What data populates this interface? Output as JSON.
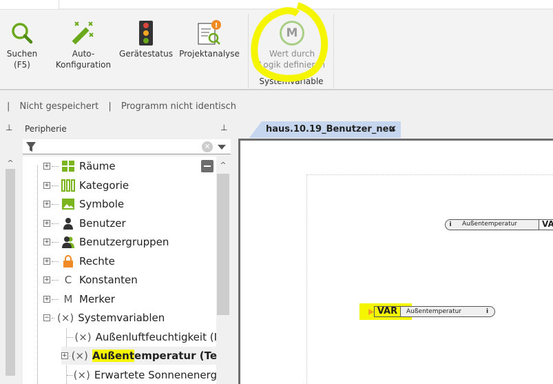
{
  "ribbon": {
    "buttons": [
      {
        "label1": "Suchen",
        "label2": "(F5)",
        "icon": "search-icon"
      },
      {
        "label1": "Auto-",
        "label2": "Konfiguration",
        "icon": "magic-wand-icon"
      },
      {
        "label1": "Gerätestatus",
        "label2": "",
        "icon": "traffic-light-icon"
      },
      {
        "label1": "Projektanalyse",
        "label2": "",
        "icon": "project-analysis-icon"
      },
      {
        "label1": "Wert durch",
        "label2": "Logik definieren",
        "icon": "m-circle-icon",
        "glyph": "M"
      }
    ],
    "group_label": "Systemvariable"
  },
  "status": {
    "sep": "|",
    "saved": "Nicht gespeichert",
    "program": "Programm nicht identisch"
  },
  "panel": {
    "title": "Peripherie",
    "pin": "⊥"
  },
  "tree": [
    {
      "label": "Räume",
      "icon": "rooms-icon",
      "expander": "+"
    },
    {
      "label": "Kategorie",
      "icon": "category-icon",
      "expander": "+"
    },
    {
      "label": "Symbole",
      "icon": "symbols-icon",
      "expander": "+"
    },
    {
      "label": "Benutzer",
      "icon": "user-icon",
      "expander": "+"
    },
    {
      "label": "Benutzergruppen",
      "icon": "user-group-icon",
      "expander": "+"
    },
    {
      "label": "Rechte",
      "icon": "lock-icon",
      "expander": "+"
    },
    {
      "label": "Konstanten",
      "icon": "constant-icon",
      "glyph": "C",
      "expander": "+"
    },
    {
      "label": "Merker",
      "icon": "marker-icon",
      "glyph": "M",
      "expander": "+"
    },
    {
      "label": "Systemvariablen",
      "icon": "variable-icon",
      "glyph": "(×)",
      "expander": "−"
    },
    {
      "label": "Außenluftfeuchtigkeit (I",
      "icon": "variable-icon",
      "glyph": "(×)"
    },
    {
      "label_hl": "Außent",
      "label_rest": "emperatur (Te",
      "icon": "variable-icon",
      "glyph": "(×)",
      "expander": "+"
    },
    {
      "label": "Erwartete Sonnenenerg",
      "icon": "variable-icon",
      "glyph": "(×)"
    }
  ],
  "document": {
    "tab": "haus.10.19_Benutzer_neu",
    "close": "✕"
  },
  "blocks": [
    {
      "name": "Außentemperatur",
      "tag": "VA"
    },
    {
      "name": "Außentemperatur",
      "tag": "VAR"
    }
  ],
  "colors": {
    "accent": "#7ab51d",
    "highlight": "#f5f500"
  }
}
